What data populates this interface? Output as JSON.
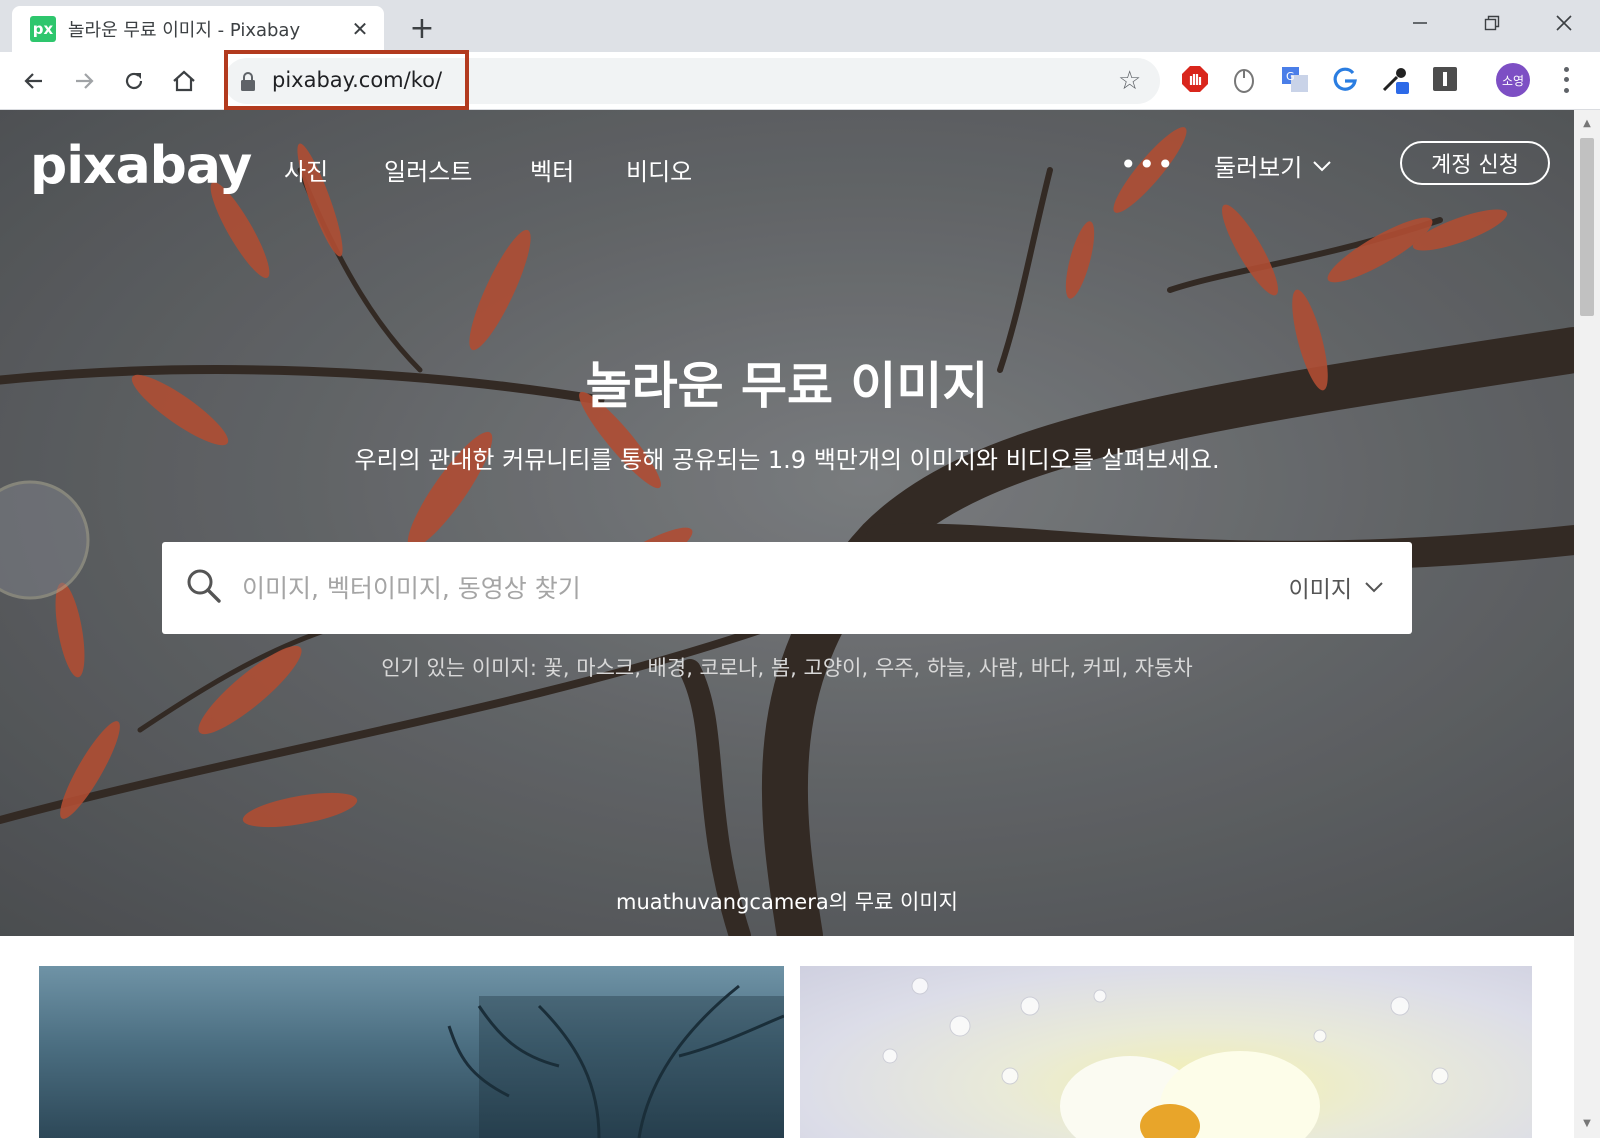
{
  "browser": {
    "tab": {
      "favicon_text": "px",
      "title": "놀라운 무료 이미지 - Pixabay"
    },
    "url": "pixabay.com/ko/",
    "profile_initials": "소영"
  },
  "site": {
    "logo": "pixabay",
    "nav": [
      "사진",
      "일러스트",
      "벡터",
      "비디오"
    ],
    "more": "•••",
    "explore": "둘러보기",
    "signup": "계정 신청"
  },
  "hero": {
    "title": "놀라운 무료 이미지",
    "subtitle": "우리의 관대한 커뮤니티를 통해 공유되는 1.9 백만개의 이미지와 비디오를 살펴보세요.",
    "search_placeholder": "이미지, 벡터이미지, 동영상 찾기",
    "search_type": "이미지",
    "popular": "인기 있는 이미지: 꽃, 마스크, 배경, 코로나, 봄, 고양이, 우주, 하늘, 사람, 바다, 커피, 자동차",
    "credit": "muathuvangcamera의 무료 이미지"
  }
}
